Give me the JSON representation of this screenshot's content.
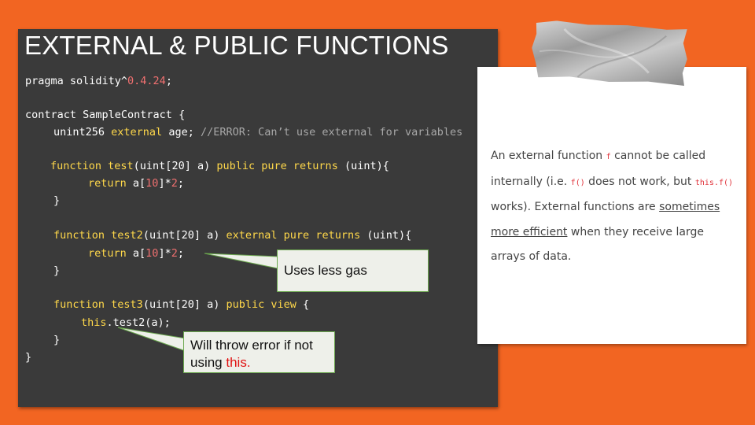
{
  "slide": {
    "title": "EXTERNAL & PUBLIC FUNCTIONS"
  },
  "code": {
    "pragma": "pragma solidity^",
    "version": "0.4.24",
    "semicolon": ";",
    "contract_open": "contract SampleContract {",
    "var_type": "unint256 ",
    "var_external": "external",
    "var_name": " age; ",
    "var_comment": "//ERROR: Can’t use external for variables",
    "fn_keyword": "function",
    "fn1_name": " test",
    "fn1_params": "(uint[20] a) ",
    "fn1_public": "public",
    "fn1_pure": "pure",
    "fn1_returns": "returns",
    "fn1_rettype": " (uint){",
    "return_kw": "return",
    "return_expr_a": " a[",
    "return_idx": "10",
    "return_expr_b": "]*",
    "return_mult": "2",
    "close_brace": "}",
    "fn2_name": " test2",
    "fn2_params": "(uint[20] a) ",
    "fn2_external": "external",
    "fn2_pure": "pure",
    "fn2_returns": "returns",
    "fn2_rettype": " (uint){",
    "fn3_name": " test3",
    "fn3_params": "(uint[20] a) ",
    "fn3_public": "public",
    "fn3_view": "view",
    "fn3_open": " {",
    "this_kw": "this",
    "this_call": ".test2(a);"
  },
  "callouts": {
    "gas": "Uses less gas",
    "error_line1": "Will throw error if not",
    "error_line2_prefix": "using ",
    "error_line2_this": "this."
  },
  "note": {
    "t1": "An external function ",
    "c1": "f",
    "t2": " cannot be called internally (i.e. ",
    "c2": "f()",
    "t3": " does not work, but ",
    "c3": "this.f()",
    "t4": " works). External functions are ",
    "link": "sometimes more efficient",
    "t5": " when they receive large arrays of data."
  },
  "colors": {
    "background": "#f26522",
    "panel": "#3a3a3a",
    "keyword": "#ffd84a",
    "number": "#f07070",
    "comment": "#a8a8a8",
    "callout_border": "#6ca94f"
  }
}
